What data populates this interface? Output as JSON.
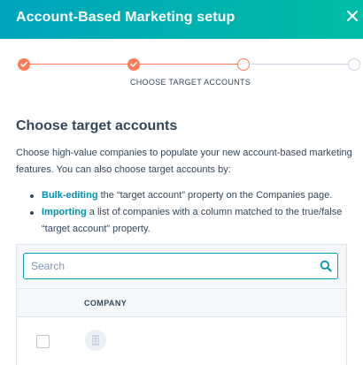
{
  "header": {
    "title": "Account-Based Marketing setup",
    "close_icon": "close-icon"
  },
  "stepper": {
    "current_step_label": "CHOOSE TARGET ACCOUNTS",
    "steps": [
      {
        "status": "done"
      },
      {
        "status": "done"
      },
      {
        "status": "current"
      },
      {
        "status": "todo"
      }
    ],
    "accent_color": "#ff7a59",
    "inactive_color": "#cbd6e2"
  },
  "main": {
    "title": "Choose target accounts",
    "description": "Choose high-value companies to populate your new account-based marketing features. You can also choose target accounts by:",
    "bullets": [
      {
        "link": "Bulk-editing",
        "text": " the “target account” property on the Companies page."
      },
      {
        "link": "Importing",
        "text": " a list of companies with a column matched to the true/false “target account” property."
      }
    ]
  },
  "table": {
    "search_placeholder": "Search",
    "search_icon": "search-icon",
    "columns": [
      "COMPANY"
    ],
    "rows": [
      {
        "company": "",
        "checked": false
      }
    ]
  },
  "colors": {
    "header_gradient_start": "#00a4bd",
    "header_gradient_end": "#00bda5",
    "link": "#0091ae",
    "text": "#33475b"
  }
}
